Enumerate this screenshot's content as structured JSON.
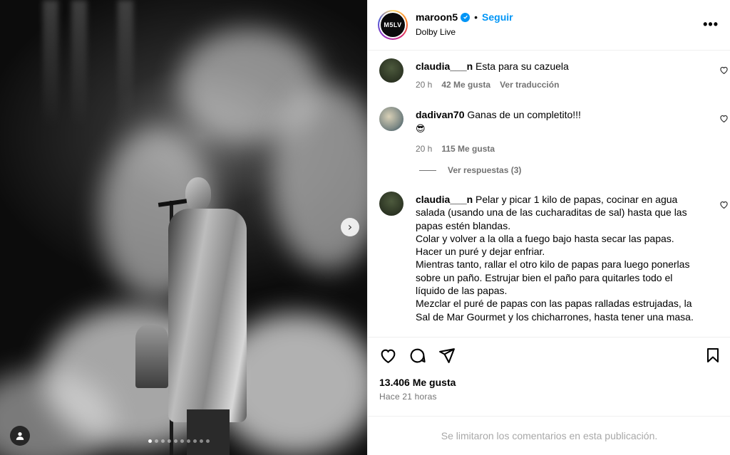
{
  "post": {
    "username": "maroon5",
    "separator": "•",
    "follow_label": "Seguir",
    "location": "Dolby Live",
    "avatar_text": "M5LV",
    "more_label": "•••"
  },
  "media": {
    "next_icon": "chevron-right-icon",
    "tag_icon": "user-icon",
    "carousel_count": 10,
    "carousel_active": 1
  },
  "comments": [
    {
      "user": "claudia___n",
      "text": "Esta para su cazuela",
      "time": "20 h",
      "likes": "42 Me gusta",
      "action": "Ver traducción"
    },
    {
      "user": "dadivan70",
      "text": "Ganas de un completito!!!",
      "emoji": "😎",
      "time": "20 h",
      "likes": "115 Me gusta",
      "view_replies": "Ver respuestas (3)"
    },
    {
      "user": "claudia___n",
      "text": "Pelar y picar 1 kilo de papas, cocinar en agua salada (usando una de las cucharaditas de sal) hasta que las papas estén blandas.",
      "lines": [
        "Colar y volver a la olla a fuego bajo hasta secar las papas.",
        "Hacer un puré y dejar enfriar.",
        "Mientras tanto, rallar el otro kilo de papas para luego ponerlas sobre un paño. Estrujar bien el paño para quitarles todo el líquido de las papas.",
        "Mezclar el puré de papas con las papas ralladas estrujadas, la Sal de Mar Gourmet y los chicharrones, hasta tener una masa."
      ]
    }
  ],
  "engagement": {
    "likes": "13.406 Me gusta",
    "posted": "Hace 21 horas"
  },
  "footer": {
    "limited_text": "Se limitaron los comentarios en esta publicación."
  },
  "colors": {
    "accent": "#0095f6",
    "muted": "#737373",
    "footer_text": "#a8a8a8"
  }
}
